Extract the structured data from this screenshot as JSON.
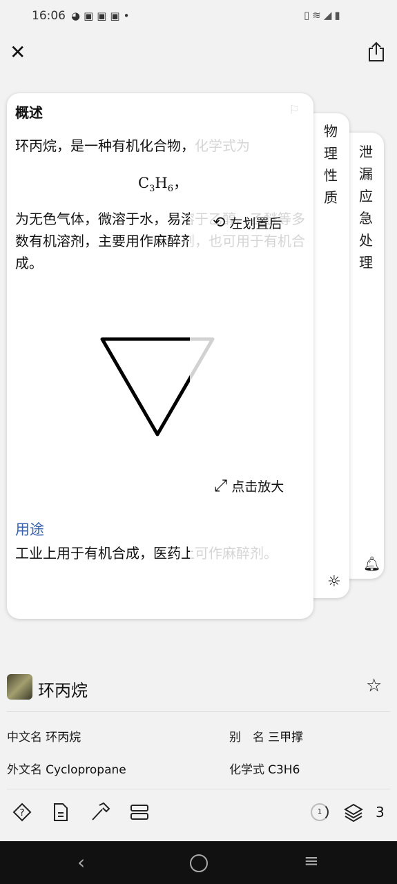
{
  "status": {
    "time": "16:06"
  },
  "cards": {
    "main": {
      "title": "概述",
      "para1": "环丙烷，是一种有机化合物，化学式为",
      "formula_c": "C",
      "formula_3": "3",
      "formula_h": "H",
      "formula_6": "6",
      "formula_comma": "，",
      "para2": "为无色气体，微溶于水，易溶于乙醇、乙醚等多数有机溶剂，主要用作麻醉剂，也可用于有机合成。",
      "usage_title": "用途",
      "usage_text": "工业上用于有机合成，医药上可作麻醉剂。",
      "hint_swipe": "左划置后",
      "hint_zoom": "点击放大"
    },
    "tab2": {
      "chars": [
        "物",
        "理",
        "性",
        "质"
      ]
    },
    "tab3": {
      "chars": [
        "泄",
        "漏",
        "应",
        "急",
        "处",
        "理"
      ]
    }
  },
  "entry": {
    "name": "环丙烷",
    "fields": [
      {
        "label": "中文名",
        "value": "环丙烷"
      },
      {
        "label": "别　名",
        "value": "三甲撑"
      },
      {
        "label": "外文名",
        "value": "Cyclopropane"
      },
      {
        "label": "化学式",
        "value": "C3H6"
      }
    ]
  },
  "toolbar": {
    "page": "1",
    "count": "3"
  },
  "colors": {
    "accent": "#3a62b0",
    "background": "#f2f2f2"
  }
}
